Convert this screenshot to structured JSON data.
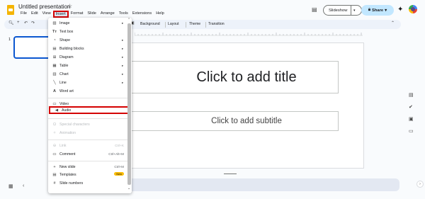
{
  "app": {
    "doc_title": "Untitled presentation",
    "star_icon": "star-icon"
  },
  "menubar": [
    "File",
    "Edit",
    "View",
    "Insert",
    "Format",
    "Slide",
    "Arrange",
    "Tools",
    "Extensions",
    "Help"
  ],
  "header": {
    "slideshow_label": "Slideshow",
    "share_label": "Share"
  },
  "toolbar": {
    "background_label": "Background",
    "layout_label": "Layout",
    "theme_label": "Theme",
    "transition_label": "Transition"
  },
  "filmstrip": {
    "slide_number": "1"
  },
  "slide": {
    "title_placeholder": "Click to add title",
    "subtitle_placeholder": "Click to add subtitle"
  },
  "insert_menu": {
    "items": [
      {
        "label": "Image",
        "icon": "image-icon",
        "submenu": true
      },
      {
        "label": "Text box",
        "icon": "text-box-icon",
        "submenu": false
      },
      {
        "label": "Shape",
        "icon": "shape-icon",
        "submenu": true
      },
      {
        "label": "Building blocks",
        "icon": "building-blocks-icon",
        "submenu": true
      },
      {
        "label": "Diagram",
        "icon": "diagram-icon",
        "submenu": true
      },
      {
        "label": "Table",
        "icon": "table-icon",
        "submenu": true
      },
      {
        "label": "Chart",
        "icon": "chart-icon",
        "submenu": true
      },
      {
        "label": "Line",
        "icon": "line-icon",
        "submenu": true
      },
      {
        "label": "Word art",
        "icon": "word-art-icon",
        "submenu": false
      },
      {
        "label": "Video",
        "icon": "video-icon",
        "submenu": false
      },
      {
        "label": "Audio",
        "icon": "audio-icon",
        "submenu": false,
        "highlighted": true
      },
      {
        "label": "Special characters",
        "icon": "special-characters-icon",
        "disabled": true
      },
      {
        "label": "Animation",
        "icon": "animation-icon",
        "disabled": true
      },
      {
        "label": "Link",
        "icon": "link-icon",
        "shortcut": "Ctrl+K",
        "disabled": true
      },
      {
        "label": "Comment",
        "icon": "comment-icon",
        "shortcut": "Ctrl+Alt+M"
      },
      {
        "label": "New slide",
        "icon": "plus-icon",
        "shortcut": "Ctrl+M"
      },
      {
        "label": "Templates",
        "icon": "templates-icon",
        "badge": "New"
      },
      {
        "label": "Slide numbers",
        "icon": "hash-icon"
      }
    ]
  },
  "colors": {
    "highlight_border": "#d40000",
    "share_bg": "#c2e7ff",
    "selected_slide_border": "#0b57d0",
    "logo": "#f4b400"
  }
}
